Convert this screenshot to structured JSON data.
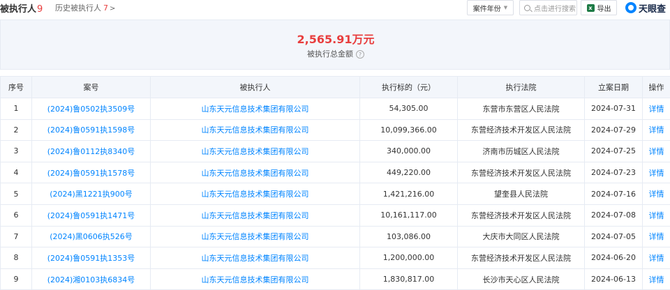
{
  "header": {
    "title": "被执行人",
    "title_count": "9",
    "history_label": "历史被执行人",
    "history_count": "7",
    "history_chevron": ">",
    "year_filter": "案件年份",
    "search_placeholder": "点击进行搜索",
    "export_label": "导出",
    "export_icon_text": "x",
    "logo_text": "天眼查"
  },
  "summary": {
    "value": "2,565.91万元",
    "label": "被执行总金额",
    "help": "?"
  },
  "table": {
    "columns": [
      "序号",
      "案号",
      "被执行人",
      "执行标的（元）",
      "执行法院",
      "立案日期",
      "操作"
    ],
    "rows": [
      {
        "no": "1",
        "case": "(2024)鲁0502执3509号",
        "party": "山东天元信息技术集团有限公司",
        "amount": "54,305.00",
        "court": "东营市东营区人民法院",
        "date": "2024-07-31",
        "action": "详情"
      },
      {
        "no": "2",
        "case": "(2024)鲁0591执1598号",
        "party": "山东天元信息技术集团有限公司",
        "amount": "10,099,366.00",
        "court": "东营经济技术开发区人民法院",
        "date": "2024-07-29",
        "action": "详情"
      },
      {
        "no": "3",
        "case": "(2024)鲁0112执8340号",
        "party": "山东天元信息技术集团有限公司",
        "amount": "340,000.00",
        "court": "济南市历城区人民法院",
        "date": "2024-07-25",
        "action": "详情"
      },
      {
        "no": "4",
        "case": "(2024)鲁0591执1578号",
        "party": "山东天元信息技术集团有限公司",
        "amount": "449,220.00",
        "court": "东营经济技术开发区人民法院",
        "date": "2024-07-23",
        "action": "详情"
      },
      {
        "no": "5",
        "case": "(2024)黑1221执900号",
        "party": "山东天元信息技术集团有限公司",
        "amount": "1,421,216.00",
        "court": "望奎县人民法院",
        "date": "2024-07-16",
        "action": "详情"
      },
      {
        "no": "6",
        "case": "(2024)鲁0591执1471号",
        "party": "山东天元信息技术集团有限公司",
        "amount": "10,161,117.00",
        "court": "东营经济技术开发区人民法院",
        "date": "2024-07-08",
        "action": "详情"
      },
      {
        "no": "7",
        "case": "(2024)黑0606执526号",
        "party": "山东天元信息技术集团有限公司",
        "amount": "103,086.00",
        "court": "大庆市大同区人民法院",
        "date": "2024-07-05",
        "action": "详情"
      },
      {
        "no": "8",
        "case": "(2024)鲁0591执1353号",
        "party": "山东天元信息技术集团有限公司",
        "amount": "1,200,000.00",
        "court": "东营经济技术开发区人民法院",
        "date": "2024-06-20",
        "action": "详情"
      },
      {
        "no": "9",
        "case": "(2024)湘0103执6834号",
        "party": "山东天元信息技术集团有限公司",
        "amount": "1,830,817.00",
        "court": "长沙市天心区人民法院",
        "date": "2024-06-13",
        "action": "详情"
      }
    ]
  }
}
